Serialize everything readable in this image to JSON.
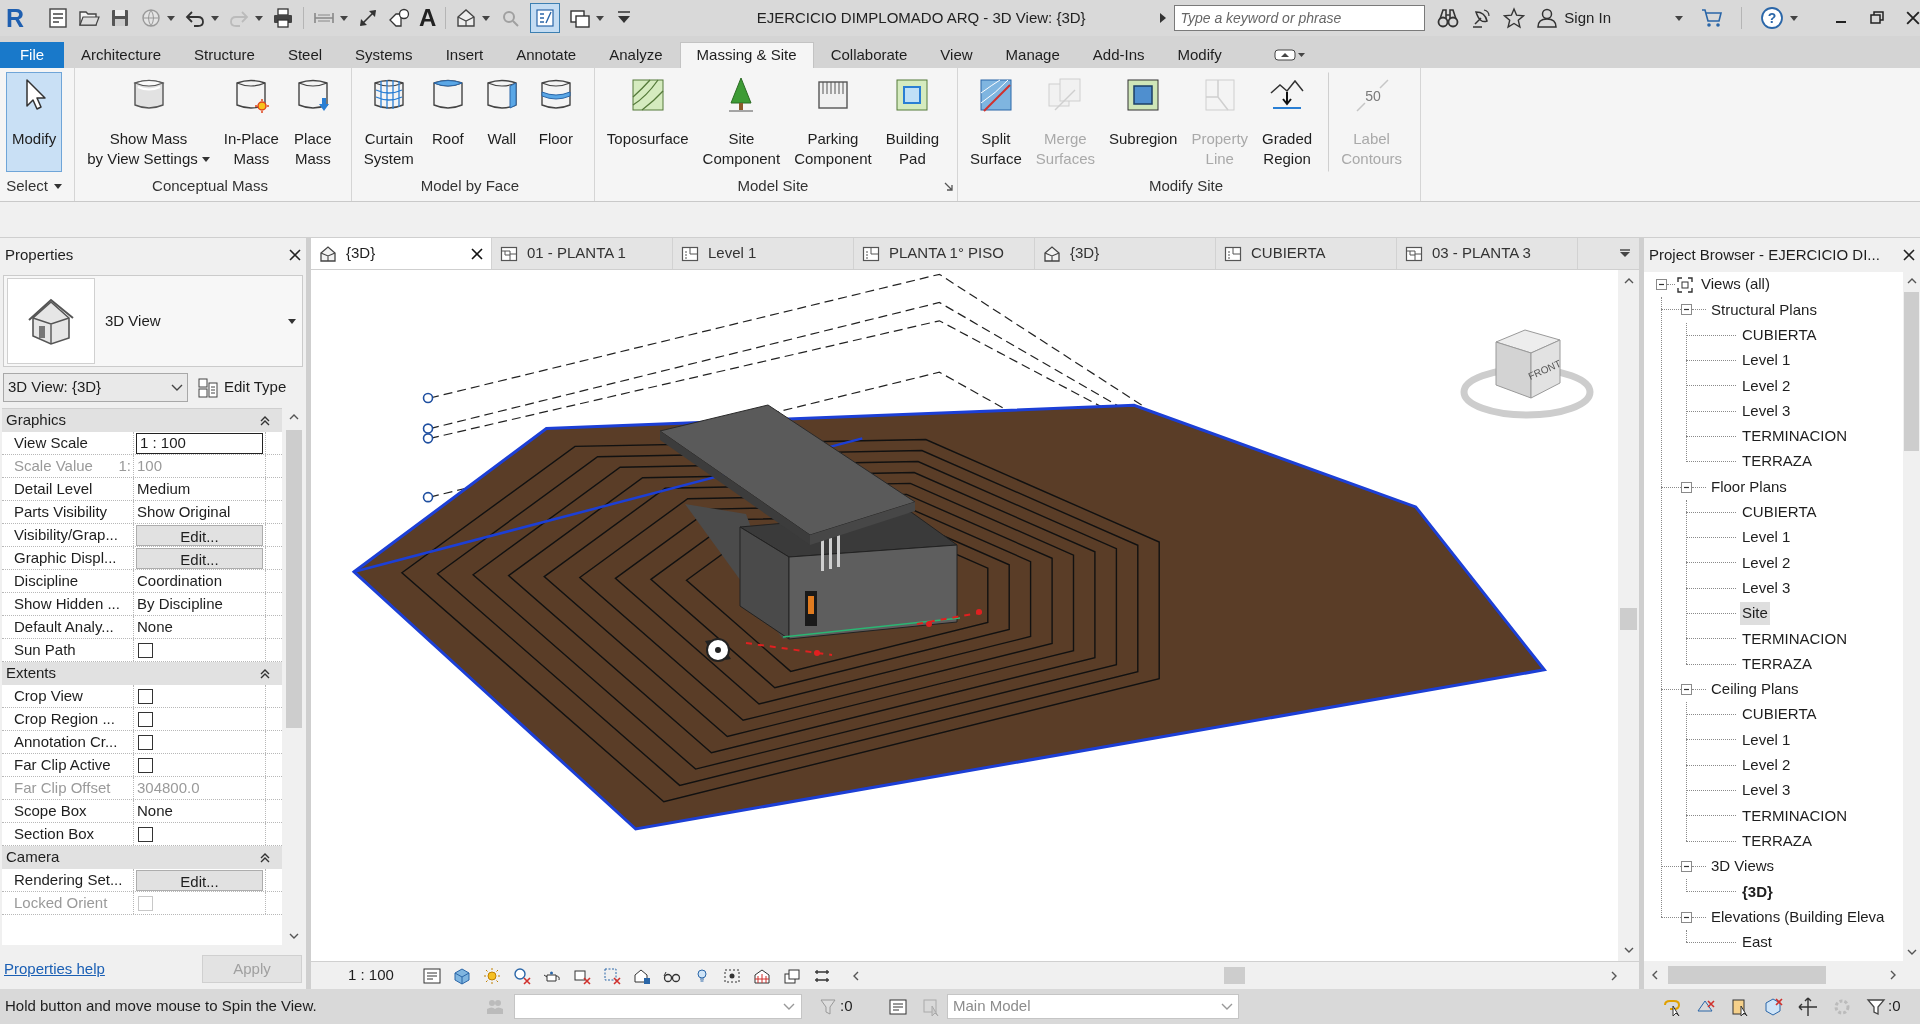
{
  "title_bar": {
    "logo": "R",
    "quick_access": {
      "text_glyph": "A",
      "thin_lines": {
        "on": true
      }
    },
    "title": "EJERCICIO DIMPLOMADO ARQ - 3D View: {3D}",
    "search": {
      "placeholder": "Type a keyword or phrase"
    },
    "sign_in": "Sign In",
    "help": "?"
  },
  "ribbon_tabs": [
    {
      "label": "File",
      "kind": "file",
      "selected": false
    },
    {
      "label": "Architecture",
      "kind": "tab",
      "selected": false
    },
    {
      "label": "Structure",
      "kind": "tab",
      "selected": false
    },
    {
      "label": "Steel",
      "kind": "tab",
      "selected": false
    },
    {
      "label": "Systems",
      "kind": "tab",
      "selected": false
    },
    {
      "label": "Insert",
      "kind": "tab",
      "selected": false
    },
    {
      "label": "Annotate",
      "kind": "tab",
      "selected": false
    },
    {
      "label": "Analyze",
      "kind": "tab",
      "selected": false
    },
    {
      "label": "Massing & Site",
      "kind": "tab",
      "selected": true
    },
    {
      "label": "Collaborate",
      "kind": "tab",
      "selected": false
    },
    {
      "label": "View",
      "kind": "tab",
      "selected": false
    },
    {
      "label": "Manage",
      "kind": "tab",
      "selected": false
    },
    {
      "label": "Add-Ins",
      "kind": "tab",
      "selected": false
    },
    {
      "label": "Modify",
      "kind": "tab",
      "selected": false
    }
  ],
  "ribbon_panels": [
    {
      "title": "Select",
      "title_dropdown": true,
      "buttons": [
        {
          "kind": "modify",
          "label_lines": [
            "Modify"
          ],
          "active": true,
          "disabled": false,
          "dropdown": false
        }
      ]
    },
    {
      "title": "Conceptual Mass",
      "buttons": [
        {
          "kind": "massview",
          "label_lines": [
            "Show Mass",
            "by View Settings"
          ],
          "active": false,
          "disabled": false,
          "dropdown": true
        },
        {
          "kind": "inplace",
          "label_lines": [
            "In-Place",
            "Mass"
          ],
          "active": false,
          "disabled": false,
          "dropdown": false
        },
        {
          "kind": "place",
          "label_lines": [
            "Place",
            "Mass"
          ],
          "active": false,
          "disabled": false,
          "dropdown": false
        }
      ]
    },
    {
      "title": "Model by Face",
      "buttons": [
        {
          "kind": "curtain",
          "label_lines": [
            "Curtain",
            "System"
          ],
          "active": false,
          "disabled": false,
          "dropdown": false
        },
        {
          "kind": "roof",
          "label_lines": [
            "Roof"
          ],
          "active": false,
          "disabled": false,
          "dropdown": false
        },
        {
          "kind": "wall",
          "label_lines": [
            "Wall"
          ],
          "active": false,
          "disabled": false,
          "dropdown": false
        },
        {
          "kind": "floor",
          "label_lines": [
            "Floor"
          ],
          "active": false,
          "disabled": false,
          "dropdown": false
        }
      ]
    },
    {
      "title": "Model Site",
      "launcher": true,
      "buttons": [
        {
          "kind": "topo",
          "label_lines": [
            "Toposurface"
          ],
          "active": false,
          "disabled": false,
          "dropdown": false
        },
        {
          "kind": "component",
          "label_lines": [
            "Site",
            "Component"
          ],
          "active": false,
          "disabled": false,
          "dropdown": false
        },
        {
          "kind": "parking",
          "label_lines": [
            "Parking",
            "Component"
          ],
          "active": false,
          "disabled": false,
          "dropdown": false
        },
        {
          "kind": "pad",
          "label_lines": [
            "Building",
            "Pad"
          ],
          "active": false,
          "disabled": false,
          "dropdown": false
        }
      ]
    },
    {
      "title": "Modify Site",
      "buttons": [
        {
          "kind": "split",
          "label_lines": [
            "Split",
            "Surface"
          ],
          "active": false,
          "disabled": false,
          "dropdown": false
        },
        {
          "kind": "merge",
          "label_lines": [
            "Merge",
            "Surfaces"
          ],
          "active": false,
          "disabled": true,
          "dropdown": false
        },
        {
          "kind": "subregion",
          "label_lines": [
            "Subregion"
          ],
          "active": false,
          "disabled": false,
          "dropdown": false
        },
        {
          "kind": "property",
          "label_lines": [
            "Property",
            "Line"
          ],
          "active": false,
          "disabled": true,
          "dropdown": false
        },
        {
          "kind": "graded",
          "label_lines": [
            "Graded",
            "Region"
          ],
          "active": false,
          "disabled": false,
          "dropdown": false
        },
        {
          "kind": "contours",
          "label_lines": [
            "Label",
            "Contours"
          ],
          "icon_text": "50",
          "active": false,
          "disabled": true,
          "dropdown": false,
          "separated": true
        }
      ]
    }
  ],
  "properties": {
    "title": "Properties",
    "type_selector": "3D View",
    "view_selector": "3D View: {3D}",
    "edit_type": "Edit Type",
    "groups": [
      {
        "title": "Graphics",
        "expanded": true,
        "rows": [
          {
            "label": "View Scale",
            "kind": "field",
            "value": "1 : 100",
            "disabled": false
          },
          {
            "label": "Scale Value",
            "prefix": "1:",
            "kind": "text",
            "value": "100",
            "disabled": true
          },
          {
            "label": "Detail Level",
            "kind": "text",
            "value": "Medium",
            "disabled": false
          },
          {
            "label": "Parts Visibility",
            "kind": "text",
            "value": "Show Original",
            "disabled": false
          },
          {
            "label": "Visibility/Grap...",
            "kind": "button",
            "value": "Edit...",
            "disabled": false
          },
          {
            "label": "Graphic Displ...",
            "kind": "button",
            "value": "Edit...",
            "disabled": false
          },
          {
            "label": "Discipline",
            "kind": "text",
            "value": "Coordination",
            "disabled": false
          },
          {
            "label": "Show Hidden ...",
            "kind": "text",
            "value": "By Discipline",
            "disabled": false
          },
          {
            "label": "Default Analy...",
            "kind": "text",
            "value": "None",
            "disabled": false
          },
          {
            "label": "Sun Path",
            "kind": "checkbox",
            "checked": false,
            "disabled": false
          }
        ]
      },
      {
        "title": "Extents",
        "expanded": true,
        "rows": [
          {
            "label": "Crop View",
            "kind": "checkbox",
            "checked": false,
            "disabled": false
          },
          {
            "label": "Crop Region ...",
            "kind": "checkbox",
            "checked": false,
            "disabled": false
          },
          {
            "label": "Annotation Cr...",
            "kind": "checkbox",
            "checked": false,
            "disabled": false
          },
          {
            "label": "Far Clip Active",
            "kind": "checkbox",
            "checked": false,
            "disabled": false
          },
          {
            "label": "Far Clip Offset",
            "kind": "text",
            "value": "304800.0",
            "disabled": true
          },
          {
            "label": "Scope Box",
            "kind": "text",
            "value": "None",
            "disabled": false
          },
          {
            "label": "Section Box",
            "kind": "checkbox",
            "checked": false,
            "disabled": false
          }
        ]
      },
      {
        "title": "Camera",
        "expanded": true,
        "rows": [
          {
            "label": "Rendering Set...",
            "kind": "button",
            "value": "Edit...",
            "disabled": false
          },
          {
            "label": "Locked Orient",
            "kind": "checkbox",
            "checked": false,
            "disabled": true
          }
        ]
      }
    ],
    "help_link": "Properties help",
    "apply": {
      "label": "Apply",
      "disabled": true
    }
  },
  "view_tabs": [
    {
      "label": "{3D}",
      "kind": "model",
      "selected": true
    },
    {
      "label": "01 - PLANTA 1",
      "kind": "floor",
      "selected": false
    },
    {
      "label": "Level 1",
      "kind": "ceiling",
      "selected": false
    },
    {
      "label": "PLANTA 1° PISO",
      "kind": "ceiling",
      "selected": false
    },
    {
      "label": "{3D}",
      "kind": "model",
      "selected": false
    },
    {
      "label": "CUBIERTA",
      "kind": "ceiling",
      "selected": false
    },
    {
      "label": "03 - PLANTA 3",
      "kind": "floor",
      "selected": false
    }
  ],
  "view": {
    "view_cube_label": "FRONT",
    "scale": "1 : 100"
  },
  "project_browser": {
    "title": "Project Browser - EJERCICIO DI...",
    "tree": [
      {
        "label": "Views (all)",
        "expanded": true,
        "selected": false,
        "children": [
          {
            "label": "Structural Plans",
            "expanded": true,
            "selected": false,
            "children": [
              {
                "label": "CUBIERTA",
                "selected": false,
                "current": false
              },
              {
                "label": "Level 1",
                "selected": false,
                "current": false
              },
              {
                "label": "Level 2",
                "selected": false,
                "current": false
              },
              {
                "label": "Level 3",
                "selected": false,
                "current": false
              },
              {
                "label": "TERMINACION",
                "selected": false,
                "current": false
              },
              {
                "label": "TERRAZA",
                "selected": false,
                "current": false
              }
            ]
          },
          {
            "label": "Floor Plans",
            "expanded": true,
            "selected": false,
            "children": [
              {
                "label": "CUBIERTA",
                "selected": false,
                "current": false
              },
              {
                "label": "Level 1",
                "selected": false,
                "current": false
              },
              {
                "label": "Level 2",
                "selected": false,
                "current": false
              },
              {
                "label": "Level 3",
                "selected": false,
                "current": false
              },
              {
                "label": "Site",
                "selected": true,
                "current": false
              },
              {
                "label": "TERMINACION",
                "selected": false,
                "current": false
              },
              {
                "label": "TERRAZA",
                "selected": false,
                "current": false
              }
            ]
          },
          {
            "label": "Ceiling Plans",
            "expanded": true,
            "selected": false,
            "children": [
              {
                "label": "CUBIERTA",
                "selected": false,
                "current": false
              },
              {
                "label": "Level 1",
                "selected": false,
                "current": false
              },
              {
                "label": "Level 2",
                "selected": false,
                "current": false
              },
              {
                "label": "Level 3",
                "selected": false,
                "current": false
              },
              {
                "label": "TERMINACION",
                "selected": false,
                "current": false
              },
              {
                "label": "TERRAZA",
                "selected": false,
                "current": false
              }
            ]
          },
          {
            "label": "3D Views",
            "expanded": true,
            "selected": false,
            "children": [
              {
                "label": "{3D}",
                "selected": false,
                "current": true
              }
            ]
          },
          {
            "label": "Elevations (Building Eleva",
            "expanded": true,
            "selected": false,
            "children": [
              {
                "label": "East",
                "selected": false,
                "current": false
              }
            ]
          }
        ]
      }
    ]
  },
  "status_bar": {
    "message": "Hold button and move mouse to Spin the View.",
    "workset_count": ":0",
    "model": {
      "value": "Main Model",
      "disabled": true
    },
    "selection_count": ":0"
  }
}
